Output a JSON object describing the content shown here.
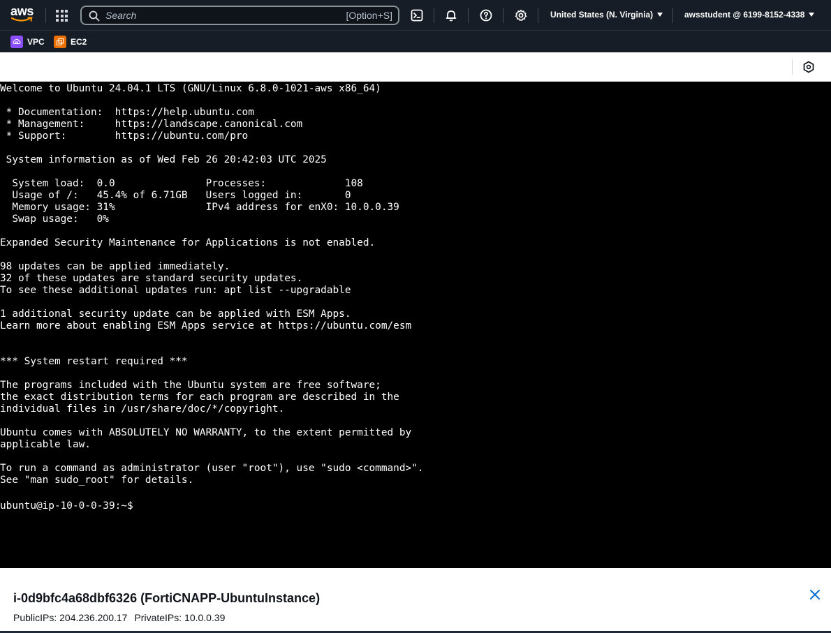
{
  "nav": {
    "logo_text": "aws",
    "search_placeholder": "Search",
    "search_shortcut": "[Option+S]",
    "region": "United States (N. Virginia)",
    "account": "awsstudent @ 6199-8152-4338"
  },
  "favorites": [
    {
      "label": "VPC",
      "color": "#8c4fff"
    },
    {
      "label": "EC2",
      "color": "#ed7100"
    }
  ],
  "terminal": {
    "output": "Welcome to Ubuntu 24.04.1 LTS (GNU/Linux 6.8.0-1021-aws x86_64)\n\n * Documentation:  https://help.ubuntu.com\n * Management:     https://landscape.canonical.com\n * Support:        https://ubuntu.com/pro\n\n System information as of Wed Feb 26 20:42:03 UTC 2025\n\n  System load:  0.0               Processes:             108\n  Usage of /:   45.4% of 6.71GB   Users logged in:       0\n  Memory usage: 31%               IPv4 address for enX0: 10.0.0.39\n  Swap usage:   0%\n\nExpanded Security Maintenance for Applications is not enabled.\n\n98 updates can be applied immediately.\n32 of these updates are standard security updates.\nTo see these additional updates run: apt list --upgradable\n\n1 additional security update can be applied with ESM Apps.\nLearn more about enabling ESM Apps service at https://ubuntu.com/esm\n\n\n*** System restart required ***\n\nThe programs included with the Ubuntu system are free software;\nthe exact distribution terms for each program are described in the\nindividual files in /usr/share/doc/*/copyright.\n\nUbuntu comes with ABSOLUTELY NO WARRANTY, to the extent permitted by\napplicable law.\n\nTo run a command as administrator (user \"root\"), use \"sudo <command>\".\nSee \"man sudo_root\" for details.\n\n",
    "prompt": "ubuntu@ip-10-0-0-39:~$ "
  },
  "instance": {
    "title": "i-0d9bfc4a68dbf6326 (FortiCNAPP-UbuntuInstance)",
    "public_ips": "PublicIPs: 204.236.200.17",
    "private_ips": "PrivateIPs: 10.0.0.39"
  },
  "colors": {
    "nav_bg": "#161d26",
    "terminal_bg": "#000000",
    "terminal_fg": "#ffffff",
    "close_icon": "#0972d3"
  }
}
